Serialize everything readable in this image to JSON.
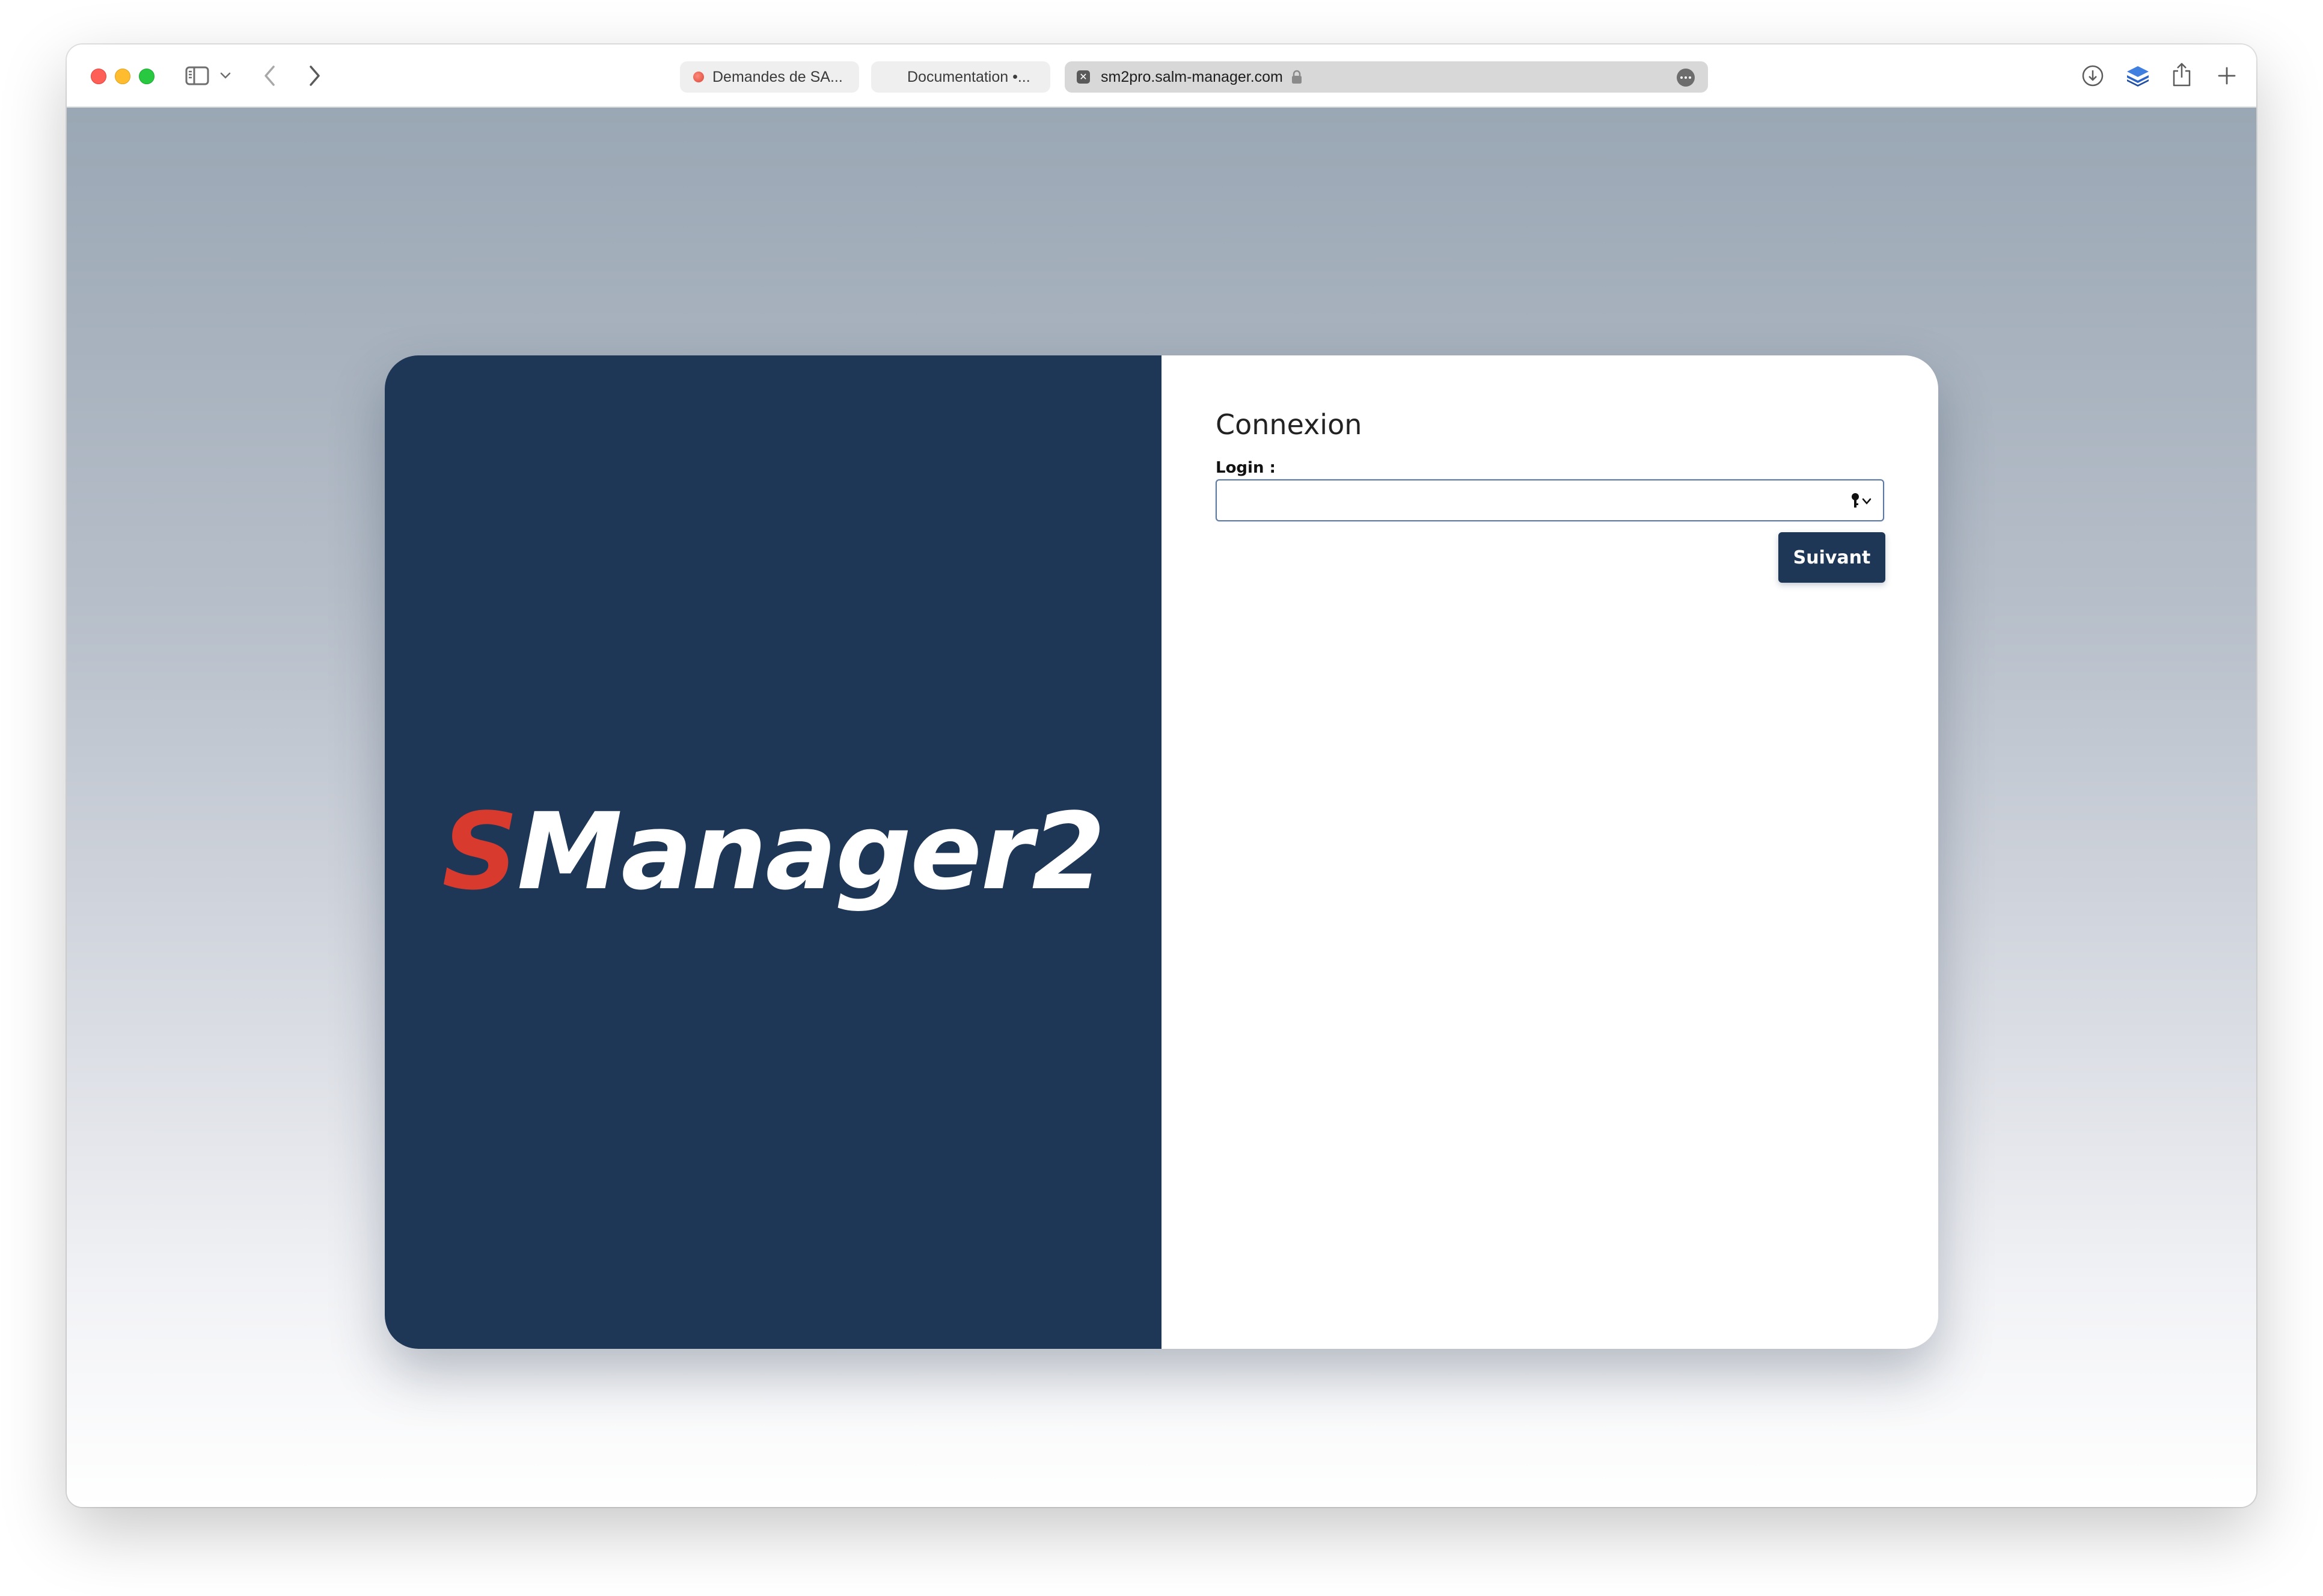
{
  "browser": {
    "tabs": [
      {
        "label": "Demandes de SA..."
      },
      {
        "label": "Documentation •..."
      },
      {
        "label": "sm2pro.salm-manager.com"
      }
    ]
  },
  "login_page": {
    "logo": {
      "first_letter": "S",
      "rest": "Manager2"
    },
    "title": "Connexion",
    "login_label": "Login :",
    "login_value": "",
    "submit_label": "Suivant"
  },
  "colors": {
    "brand_panel": "#1f3756",
    "logo_accent": "#d83a2e",
    "button": "#1f3756"
  },
  "icons": {
    "sidebar": "sidebar-icon",
    "back": "chevron-left-icon",
    "forward": "chevron-right-icon",
    "download": "download-icon",
    "layers": "layers-icon",
    "share": "share-icon",
    "new_tab": "plus-icon",
    "password_manager": "key-icon"
  }
}
